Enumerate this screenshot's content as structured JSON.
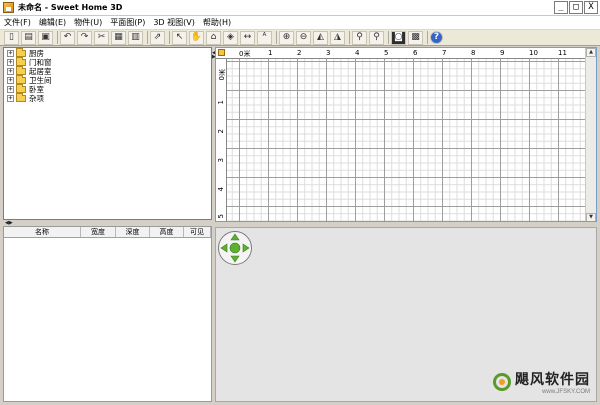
{
  "window": {
    "title": "未命名 - Sweet Home 3D",
    "btn_min": "_",
    "btn_max": "□",
    "btn_close": "X"
  },
  "menu": [
    "文件(F)",
    "编辑(E)",
    "物件(U)",
    "平面图(P)",
    "3D 视图(V)",
    "帮助(H)"
  ],
  "toolbar": {
    "groups": [
      [
        "new-icon",
        "open-icon",
        "save-icon"
      ],
      [
        "undo-icon",
        "redo-icon",
        "cut-icon",
        "copy-icon",
        "paste-icon"
      ],
      [
        "add-furniture-icon"
      ],
      [
        "select-icon",
        "pan-icon",
        "create-walls-icon",
        "create-rooms-icon",
        "create-dimensions-icon",
        "create-labels-icon"
      ],
      [
        "increase-text-icon",
        "decrease-text-icon",
        "bold-text-icon",
        "italic-text-icon"
      ],
      [
        "zoom-in-icon",
        "zoom-out-icon"
      ],
      [
        "create-photo-icon",
        "create-video-icon"
      ],
      [
        "help-icon"
      ]
    ]
  },
  "catalog": {
    "items": [
      "厨房",
      "门和窗",
      "起居室",
      "卫生间",
      "卧室",
      "杂项"
    ]
  },
  "furniture_table": {
    "columns": [
      "名称",
      "宽度",
      "深度",
      "高度",
      "可见"
    ]
  },
  "plan": {
    "ruler_top": [
      "0米",
      "1",
      "2",
      "3",
      "4",
      "5",
      "6",
      "7",
      "8",
      "9",
      "10",
      "11"
    ],
    "ruler_left": [
      "0米",
      "1",
      "2",
      "3",
      "4",
      "5"
    ]
  },
  "watermark": {
    "name": "飓风软件园",
    "url": "www.JFSKY.COM"
  },
  "colors": {
    "accent": "#4a86c8",
    "nav_green": "#5fb030"
  }
}
